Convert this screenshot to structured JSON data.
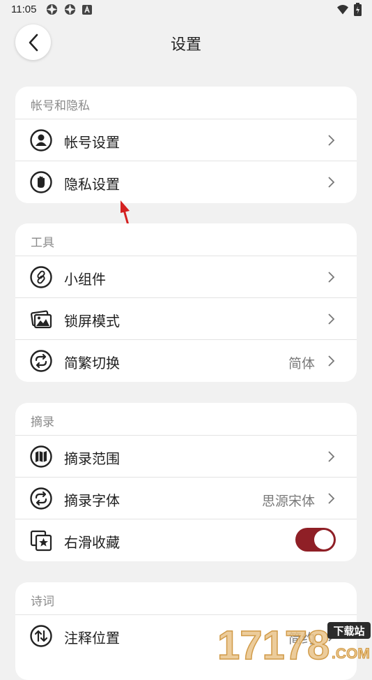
{
  "status_bar": {
    "time": "11:05"
  },
  "header": {
    "title": "设置"
  },
  "sections": [
    {
      "title": "帐号和隐私",
      "items": [
        {
          "label": "帐号设置",
          "icon": "person-icon"
        },
        {
          "label": "隐私设置",
          "icon": "hand-icon"
        }
      ]
    },
    {
      "title": "工具",
      "items": [
        {
          "label": "小组件",
          "icon": "link-icon"
        },
        {
          "label": "锁屏模式",
          "icon": "images-icon"
        },
        {
          "label": "简繁切换",
          "icon": "sync-icon",
          "value": "简体"
        }
      ]
    },
    {
      "title": "摘录",
      "items": [
        {
          "label": "摘录范围",
          "icon": "map-icon"
        },
        {
          "label": "摘录字体",
          "icon": "sync-icon",
          "value": "思源宋体"
        },
        {
          "label": "右滑收藏",
          "icon": "star-card-icon",
          "toggle": true
        }
      ]
    },
    {
      "title": "诗词",
      "items": [
        {
          "label": "注释位置",
          "icon": "swap-vertical-icon",
          "value": "简约"
        }
      ]
    }
  ],
  "watermark": {
    "text": "17178",
    "badge": "下载站",
    "domain": ".COM"
  },
  "colors": {
    "accent": "#8f1f26",
    "background": "#f1f1f1",
    "annotation_arrow": "#d42020"
  }
}
